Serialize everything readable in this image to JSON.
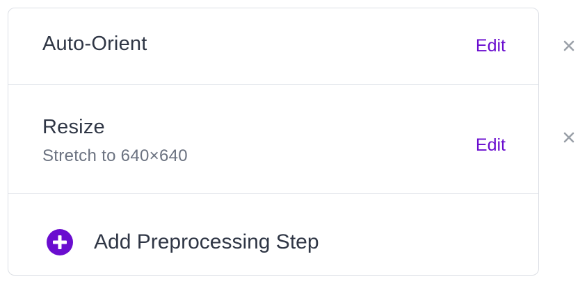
{
  "steps": [
    {
      "title": "Auto-Orient",
      "subtitle": "",
      "edit_label": "Edit"
    },
    {
      "title": "Resize",
      "subtitle": "Stretch to 640×640",
      "edit_label": "Edit"
    }
  ],
  "add_step": {
    "label": "Add Preprocessing Step",
    "icon": "plus-circle-icon"
  },
  "colors": {
    "accent": "#6a0dcf",
    "text": "#2f3645",
    "muted": "#6b7280",
    "border": "#dcdfe5",
    "close": "#9aa0a8"
  }
}
